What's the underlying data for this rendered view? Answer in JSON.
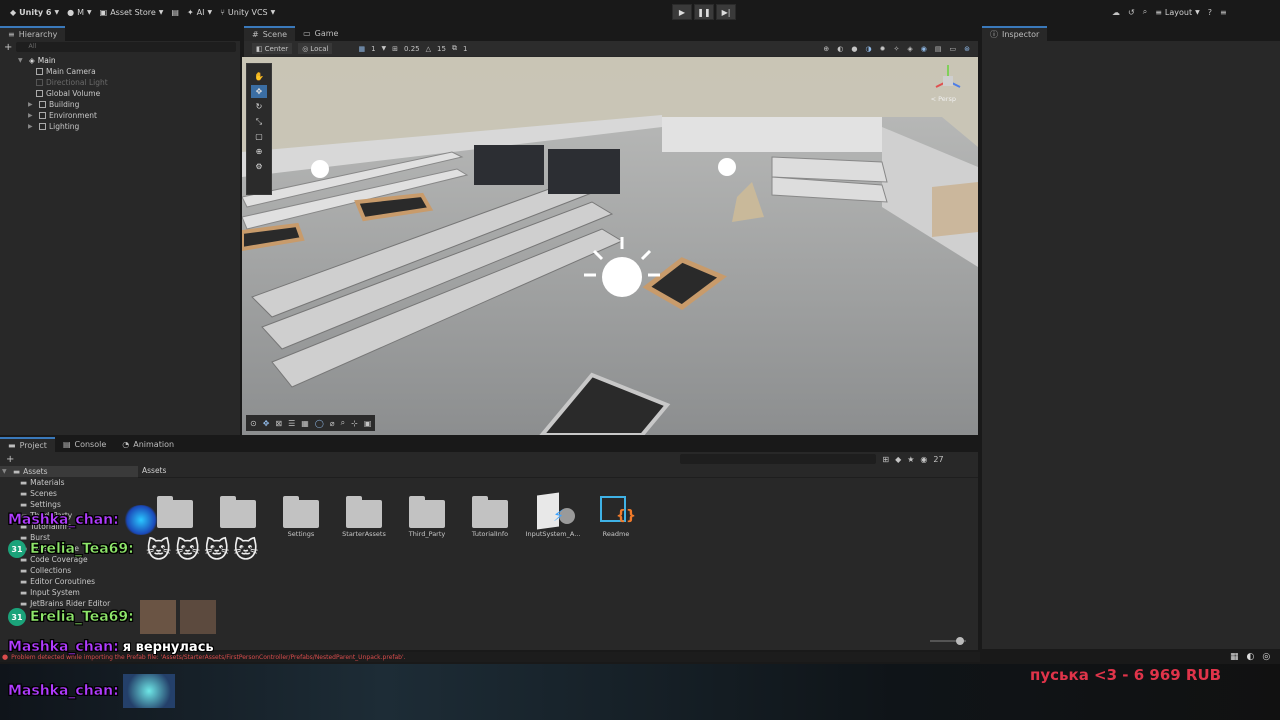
{
  "topbar": {
    "account": "Unity 6",
    "user": "M",
    "asset_store": "Asset Store",
    "ai": "AI",
    "vcs": "Unity VCS",
    "layout": "Layout"
  },
  "hierarchy": {
    "tab": "Hierarchy",
    "search_placeholder": "All",
    "scene": "Main",
    "items": [
      "Main Camera",
      "Directional Light",
      "Global Volume",
      "Building",
      "Environment",
      "Lighting"
    ]
  },
  "scene": {
    "tab_scene": "Scene",
    "tab_game": "Game",
    "pivot": "Center",
    "space": "Local",
    "grid_value": "1",
    "snap_value": "0.25",
    "rotate_snap": "15",
    "scale_snap": "1",
    "persp_label": "< Persp"
  },
  "inspector": {
    "tab": "Inspector"
  },
  "project": {
    "tab_project": "Project",
    "tab_console": "Console",
    "tab_animation": "Animation",
    "breadcrumb": "Assets",
    "count": "27",
    "tree": [
      "Assets",
      "Materials",
      "Scenes",
      "Settings",
      "Third_Party",
      "TutorialInfo",
      "Burst",
      "Cinemachine",
      "Code Coverage",
      "Collections",
      "Editor Coroutines",
      "Input System",
      "JetBrains Rider Editor"
    ],
    "assets": [
      "Settings",
      "StarterAssets",
      "Third_Party",
      "TutorialInfo",
      "InputSystem_A...",
      "Readme"
    ],
    "status_error": "Problem detected while importing the Prefab file: 'Assets/StarterAssets/FirstPersonController/Prefabs/NestedParent_Unpack.prefab'."
  },
  "chat": [
    {
      "user": "Mashka_chan:",
      "msg": ""
    },
    {
      "user": "Erelia_Tea69:",
      "msg": "",
      "badge": "31"
    },
    {
      "user": "Erelia_Tea69:",
      "msg": "",
      "badge": "31"
    },
    {
      "user": "Mashka_chan:",
      "msg": "я вернулась"
    },
    {
      "user": "Mashka_chan:",
      "msg": ""
    }
  ],
  "donation": "пуська <3 - 6 969 RUB",
  "colors": {
    "accent": "#3a79bb",
    "mashka": "#b13cff",
    "erelia": "#8ee66a",
    "donation": "#e0344a",
    "error": "#d94c4c"
  }
}
